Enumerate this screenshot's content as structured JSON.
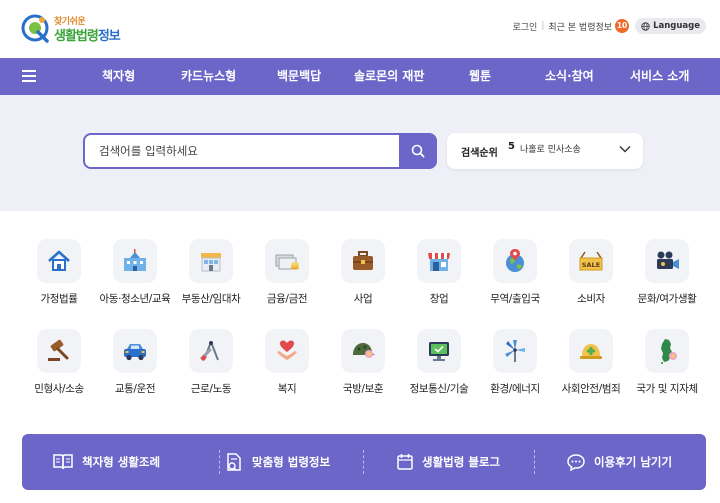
{
  "header": {
    "logo_small": "찾기쉬운",
    "logo_main_green": "생활법령",
    "logo_main_blue": "정보",
    "login": "로그인",
    "recent_label": "최근 본 법령정보",
    "recent_count": "10",
    "language": "Language"
  },
  "nav": {
    "items": [
      {
        "label": "책자형"
      },
      {
        "label": "카드뉴스형"
      },
      {
        "label": "백문백답"
      },
      {
        "label": "솔로몬의 재판"
      },
      {
        "label": "웹툰"
      },
      {
        "label": "소식·참여"
      },
      {
        "label": "서비스 소개"
      }
    ]
  },
  "search": {
    "placeholder": "검색어를 입력하세요",
    "rank_label": "검색순위",
    "rank_number": "5",
    "rank_term": "나홀로 민사소송"
  },
  "categories": [
    {
      "label": "가정법률",
      "icon": "house-icon"
    },
    {
      "label": "아동·청소년/교육",
      "icon": "school-icon"
    },
    {
      "label": "부동산/임대차",
      "icon": "store-building-icon"
    },
    {
      "label": "금융/금전",
      "icon": "money-icon"
    },
    {
      "label": "사업",
      "icon": "briefcase-icon"
    },
    {
      "label": "창업",
      "icon": "shop-icon"
    },
    {
      "label": "무역/출입국",
      "icon": "globe-pin-icon"
    },
    {
      "label": "소비자",
      "icon": "sale-sign-icon"
    },
    {
      "label": "문화/여가생활",
      "icon": "video-camera-icon"
    },
    {
      "label": "민형사/소송",
      "icon": "gavel-icon"
    },
    {
      "label": "교통/운전",
      "icon": "car-icon"
    },
    {
      "label": "근로/노동",
      "icon": "tools-icon"
    },
    {
      "label": "복지",
      "icon": "heart-hands-icon"
    },
    {
      "label": "국방/보훈",
      "icon": "helmet-icon"
    },
    {
      "label": "정보통신/기술",
      "icon": "monitor-icon"
    },
    {
      "label": "환경/에너지",
      "icon": "windmill-icon"
    },
    {
      "label": "사회안전/범죄",
      "icon": "safety-helmet-icon"
    },
    {
      "label": "국가 및 지자체",
      "icon": "korea-map-icon"
    }
  ],
  "bottom_links": [
    {
      "label": "책자형 생활조례",
      "icon": "book-icon"
    },
    {
      "label": "맞춤형 법령정보",
      "icon": "document-search-icon"
    },
    {
      "label": "생활법령 블로그",
      "icon": "calendar-icon"
    },
    {
      "label": "이용후기 남기기",
      "icon": "chat-bubble-icon"
    }
  ],
  "colors": {
    "brand_purple": "#6c66c8",
    "badge_orange": "#f06a2a",
    "search_band": "#eff0f7",
    "logo_green": "#3aa63a",
    "logo_blue": "#2a6fc9"
  }
}
